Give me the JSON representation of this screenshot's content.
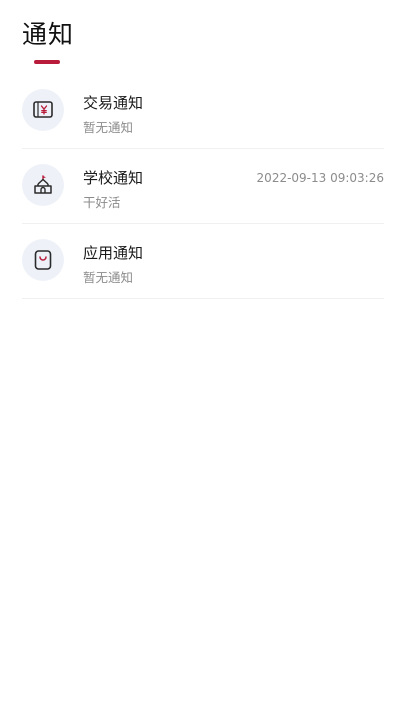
{
  "header": {
    "title": "通知"
  },
  "colors": {
    "accent": "#b81c3a",
    "icon_bg": "#eef2f8",
    "subtext": "#8c8c8c",
    "divider": "#f0f0f0"
  },
  "notifications": [
    {
      "icon": "receipt-yen-icon",
      "title": "交易通知",
      "subtitle": "暂无通知",
      "time": ""
    },
    {
      "icon": "school-building-icon",
      "title": "学校通知",
      "subtitle": "干好活",
      "time": "2022-09-13 09:03:26"
    },
    {
      "icon": "shopping-bag-icon",
      "title": "应用通知",
      "subtitle": "暂无通知",
      "time": ""
    }
  ]
}
